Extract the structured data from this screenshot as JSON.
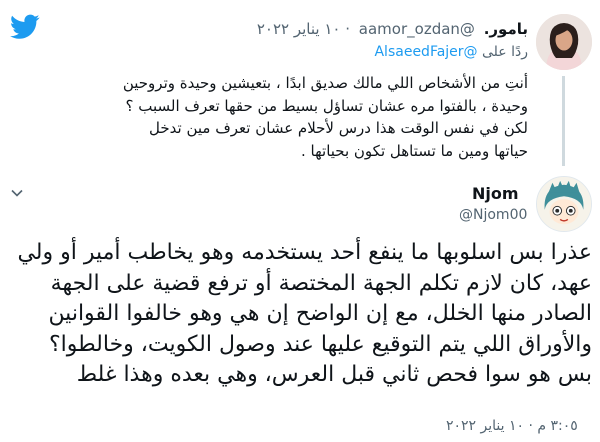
{
  "header": {
    "logo_icon": "twitter-bird-icon",
    "brand_color": "#1d9bf0"
  },
  "parent_tweet": {
    "author_name": "بامور.",
    "author_handle": "@aamor_ozdan",
    "date": "· ١٠ يناير ٢٠٢٢",
    "reply_prefix": "ردًا على",
    "reply_to": "@AlsaeedFajer",
    "text": "أنتِ من الأشخاص اللي مالك صديق ابدًا ، بتعيشين وحيدة وتروحين وحيدة ، بالفتوا مره عشان تساؤل بسيط من حقها تعرف السبب ؟ لكن في نفس الوقت هذا درس لأحلام عشان تعرف مين تدخل حياتها ومين ما تستاهل تكون بحياتها ."
  },
  "main_tweet": {
    "author_name": "Njom",
    "author_handle": "@Njom00",
    "text": "عذرا بس اسلوبها ما ينفع أحد يستخدمه وهو يخاطب أمير أو ولي عهد، كان لازم تكلم الجهة المختصة أو ترفع قضية على الجهة الصادر منها الخلل، مع إن الواضح إن هي وهو خالفوا القوانين والأوراق اللي يتم التوقيع عليها عند وصول الكويت، وخالطوا؟ بس هو سوا فحص ثاني قبل العرس، وهي بعده وهذا غلط",
    "timestamp": "٣:٠٥ م · ١٠ يناير ٢٠٢٢",
    "more_icon": "chevron-down-icon"
  }
}
